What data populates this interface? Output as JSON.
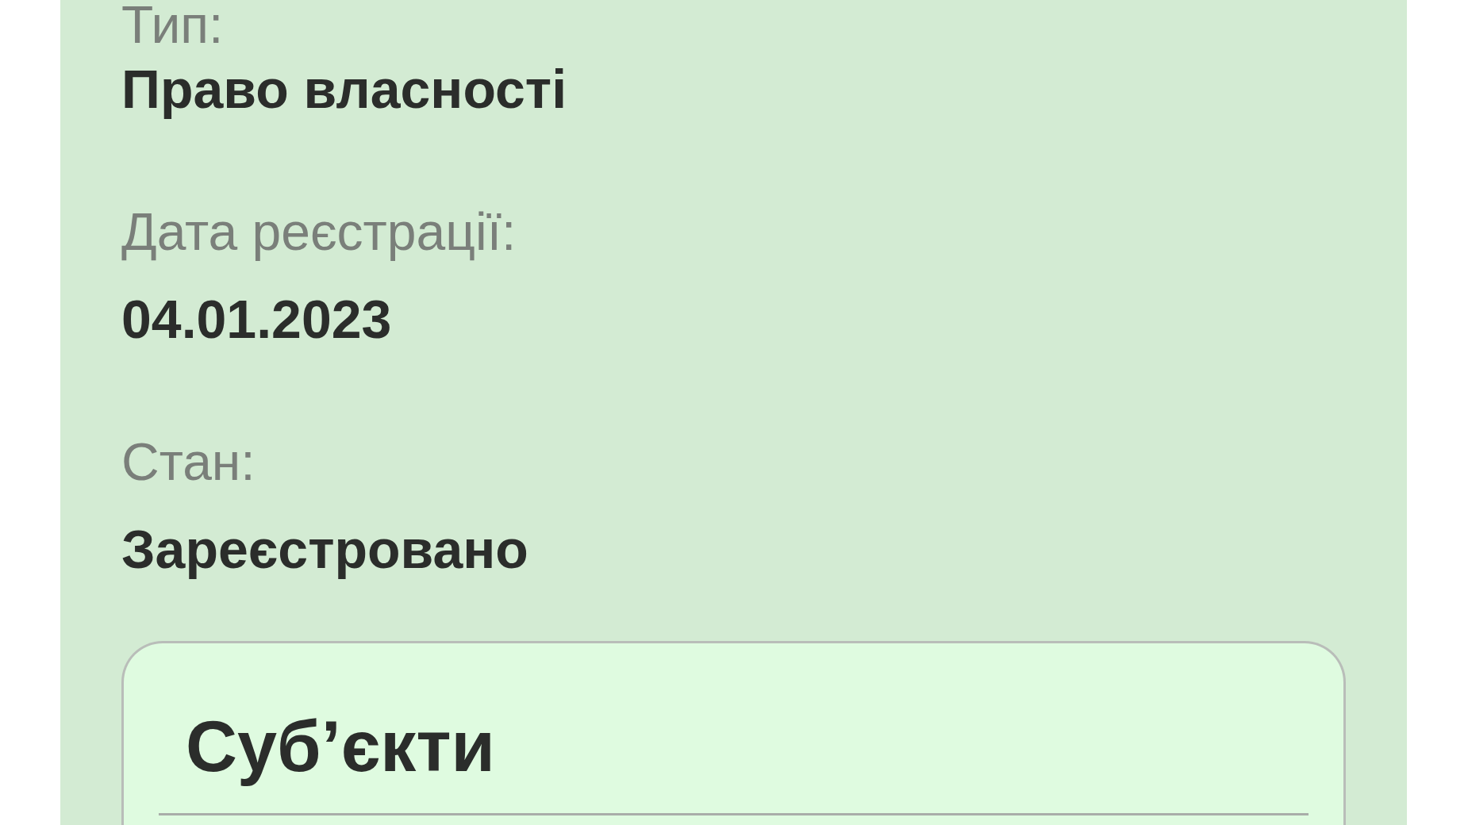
{
  "fields": [
    {
      "label": "Тип:",
      "value": "Право власності"
    },
    {
      "label": "Дата реєстрації:",
      "value": "04.01.2023"
    },
    {
      "label": "Стан:",
      "value": "Зареєстровано"
    }
  ],
  "subjects_card": {
    "title": "Суб’єкти"
  }
}
